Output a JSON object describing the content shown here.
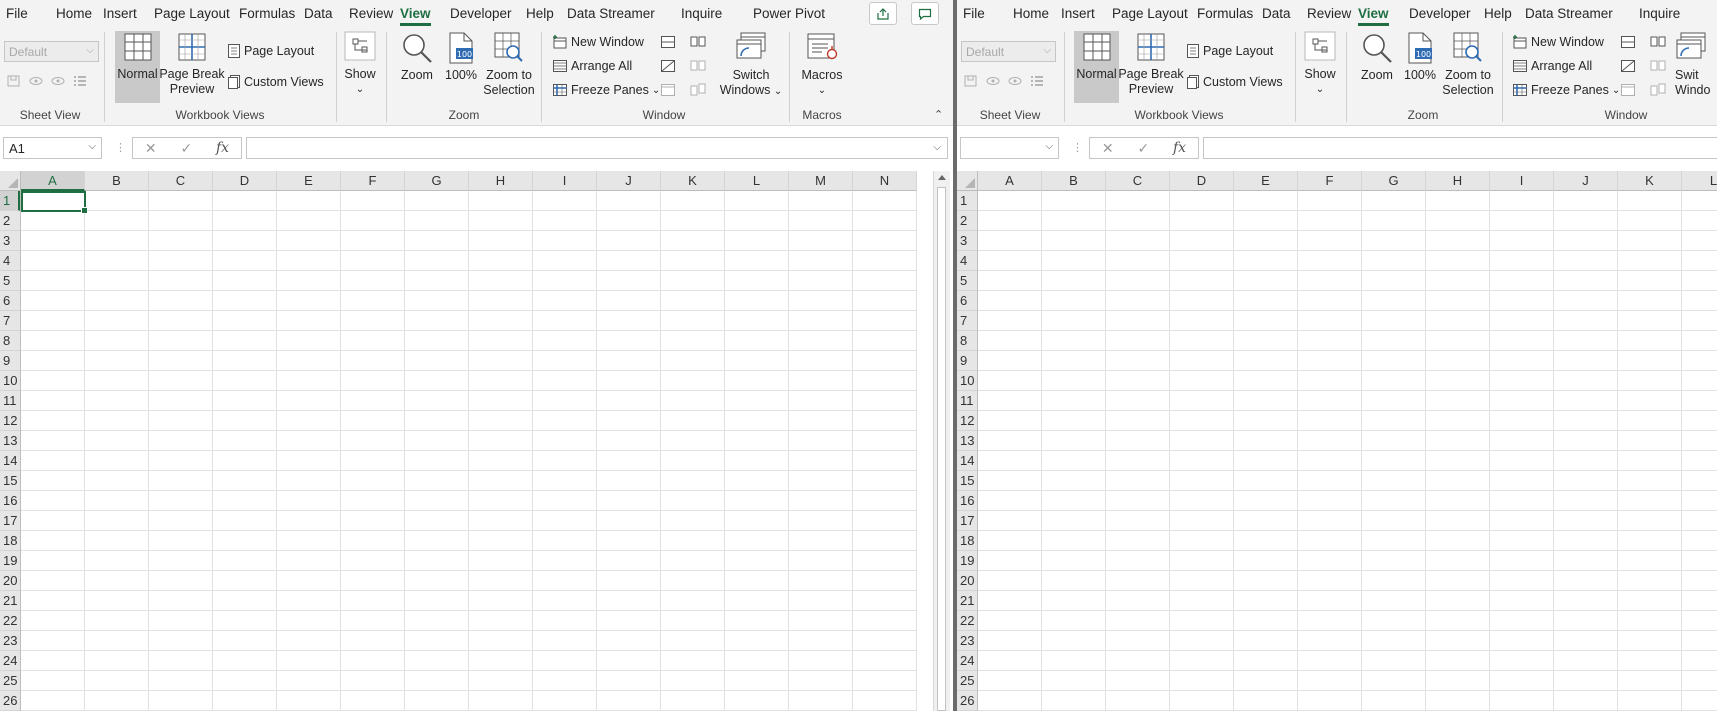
{
  "left": {
    "tabs": [
      "File",
      "Home",
      "Insert",
      "Page Layout",
      "Formulas",
      "Data",
      "Review",
      "View",
      "Developer",
      "Help",
      "Data Streamer",
      "Inquire",
      "Power Pivot"
    ],
    "active_tab": "View",
    "sheet_view": {
      "select_value": "Default",
      "group_label": "Sheet View"
    },
    "workbook_views": {
      "normal": "Normal",
      "page_break_1": "Page Break",
      "page_break_2": "Preview",
      "page_layout": "Page Layout",
      "custom_views": "Custom Views",
      "group_label": "Workbook Views"
    },
    "show": {
      "label": "Show"
    },
    "zoom": {
      "zoom": "Zoom",
      "hundred": "100%",
      "sel_1": "Zoom to",
      "sel_2": "Selection",
      "group_label": "Zoom",
      "icon_text": "100"
    },
    "window": {
      "new_window": "New Window",
      "arrange_all": "Arrange All",
      "freeze_panes": "Freeze Panes",
      "switch_1": "Switch",
      "switch_2": "Windows",
      "group_label": "Window"
    },
    "macros": {
      "label": "Macros",
      "group_label": "Macros"
    },
    "name_box": "A1",
    "fx_label": "fx",
    "columns": [
      "A",
      "B",
      "C",
      "D",
      "E",
      "F",
      "G",
      "H",
      "I",
      "J",
      "K",
      "L",
      "M",
      "N"
    ],
    "rows": [
      "1",
      "2",
      "3",
      "4",
      "5",
      "6",
      "7",
      "8",
      "9",
      "10",
      "11",
      "12",
      "13",
      "14",
      "15",
      "16",
      "17",
      "18",
      "19",
      "20",
      "21",
      "22",
      "23",
      "24",
      "25",
      "26"
    ]
  },
  "right": {
    "tabs": [
      "File",
      "Home",
      "Insert",
      "Page Layout",
      "Formulas",
      "Data",
      "Review",
      "View",
      "Developer",
      "Help",
      "Data Streamer",
      "Inquire"
    ],
    "active_tab": "View",
    "sheet_view": {
      "select_value": "Default",
      "group_label": "Sheet View"
    },
    "workbook_views": {
      "normal": "Normal",
      "page_break_1": "Page Break",
      "page_break_2": "Preview",
      "page_layout": "Page Layout",
      "custom_views": "Custom Views",
      "group_label": "Workbook Views"
    },
    "show": {
      "label": "Show"
    },
    "zoom": {
      "zoom": "Zoom",
      "hundred": "100%",
      "sel_1": "Zoom to",
      "sel_2": "Selection",
      "group_label": "Zoom",
      "icon_text": "100"
    },
    "window": {
      "new_window": "New Window",
      "arrange_all": "Arrange All",
      "freeze_panes": "Freeze Panes",
      "switch_1": "Swit",
      "switch_2": "Windo",
      "group_label": "Window"
    },
    "name_box": "",
    "fx_label": "fx",
    "columns": [
      "A",
      "B",
      "C",
      "D",
      "E",
      "F",
      "G",
      "H",
      "I",
      "J",
      "K",
      "L"
    ],
    "rows": [
      "1",
      "2",
      "3",
      "4",
      "5",
      "6",
      "7",
      "8",
      "9",
      "10",
      "11",
      "12",
      "13",
      "14",
      "15",
      "16",
      "17",
      "18",
      "19",
      "20",
      "21",
      "22",
      "23",
      "24",
      "25",
      "26"
    ]
  },
  "colors": {
    "accent": "#1e6e42",
    "ribbon_bg": "#f3f3f3",
    "grid_line": "#e1e1e1",
    "header_bg": "#e6e6e6"
  },
  "icons": [
    "share-icon",
    "comment-icon",
    "normal-view-icon",
    "page-break-icon",
    "page-layout-icon",
    "custom-views-icon",
    "show-icon",
    "zoom-icon",
    "zoom-100-icon",
    "zoom-selection-icon",
    "new-window-icon",
    "arrange-all-icon",
    "freeze-panes-icon",
    "switch-windows-icon",
    "macros-icon",
    "cancel-icon",
    "enter-icon",
    "fx-icon"
  ]
}
